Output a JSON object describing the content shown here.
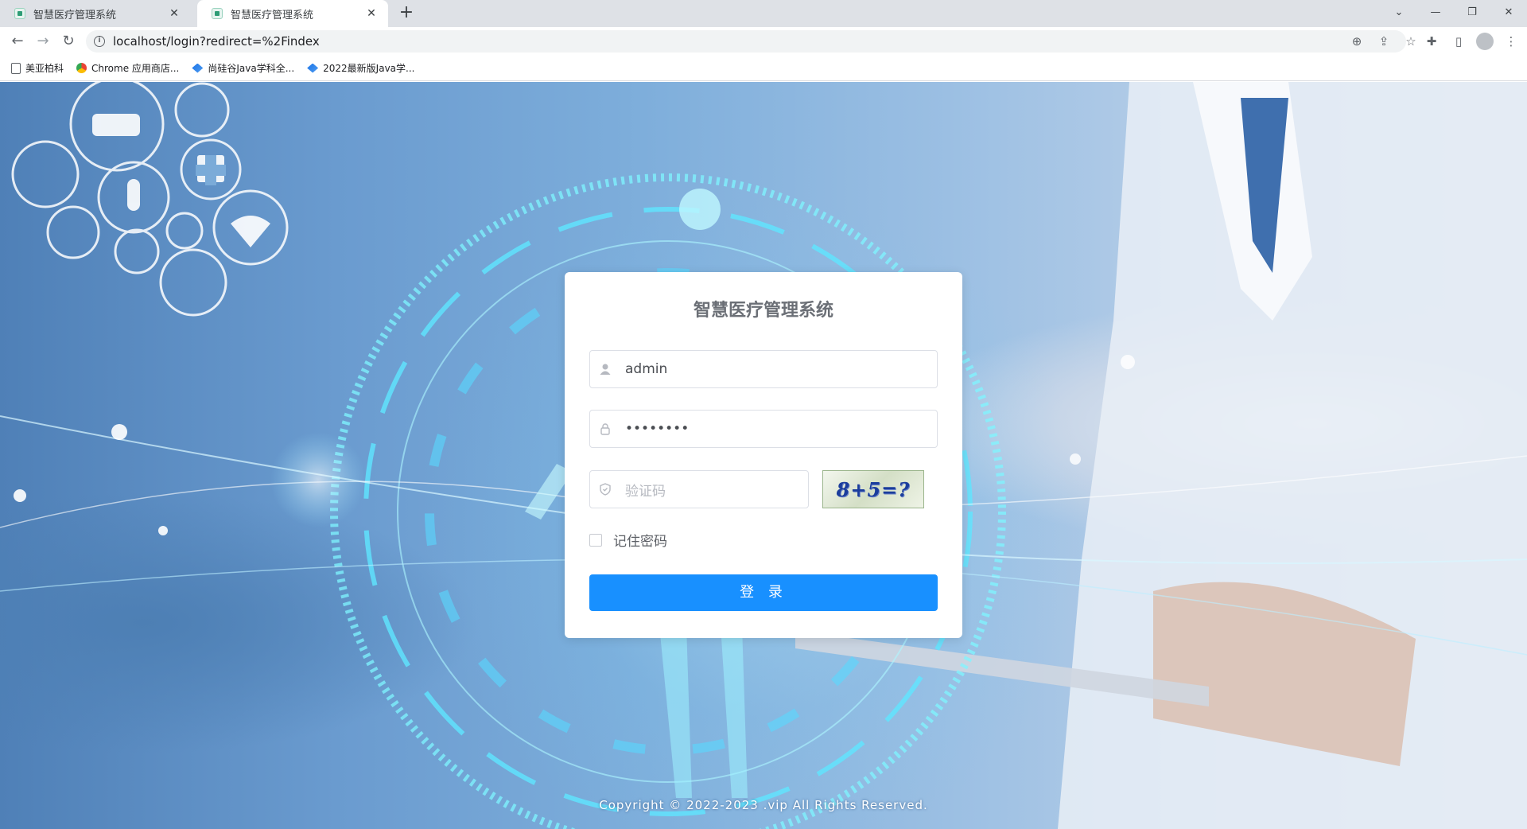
{
  "browser": {
    "tabs": [
      {
        "title": "智慧医疗管理系统",
        "close": "✕",
        "active": false
      },
      {
        "title": "智慧医疗管理系统",
        "close": "✕",
        "active": true
      }
    ],
    "new_tab": "+",
    "url": "localhost/login?redirect=%2Findex",
    "bookmarks": [
      {
        "label": "美亚柏科",
        "icon": "page-icon"
      },
      {
        "label": "Chrome 应用商店...",
        "icon": "chrome-icon"
      },
      {
        "label": "尚硅谷Java学科全...",
        "icon": "bookmark-icon"
      },
      {
        "label": "2022最新版Java学...",
        "icon": "bookmark-icon"
      }
    ]
  },
  "login": {
    "title": "智慧医疗管理系统",
    "username": "admin",
    "password_masked": "••••••••",
    "captcha_placeholder": "验证码",
    "captcha_text": "8+5=?",
    "remember_label": "记住密码",
    "remember_checked": false,
    "submit_label": "登 录"
  },
  "footer": {
    "text": "Copyright © 2022-2023 .vip All Rights Reserved."
  },
  "colors": {
    "primary": "#1890ff",
    "title_text": "#6b6f76",
    "background_blue": "#6a9bcf"
  }
}
